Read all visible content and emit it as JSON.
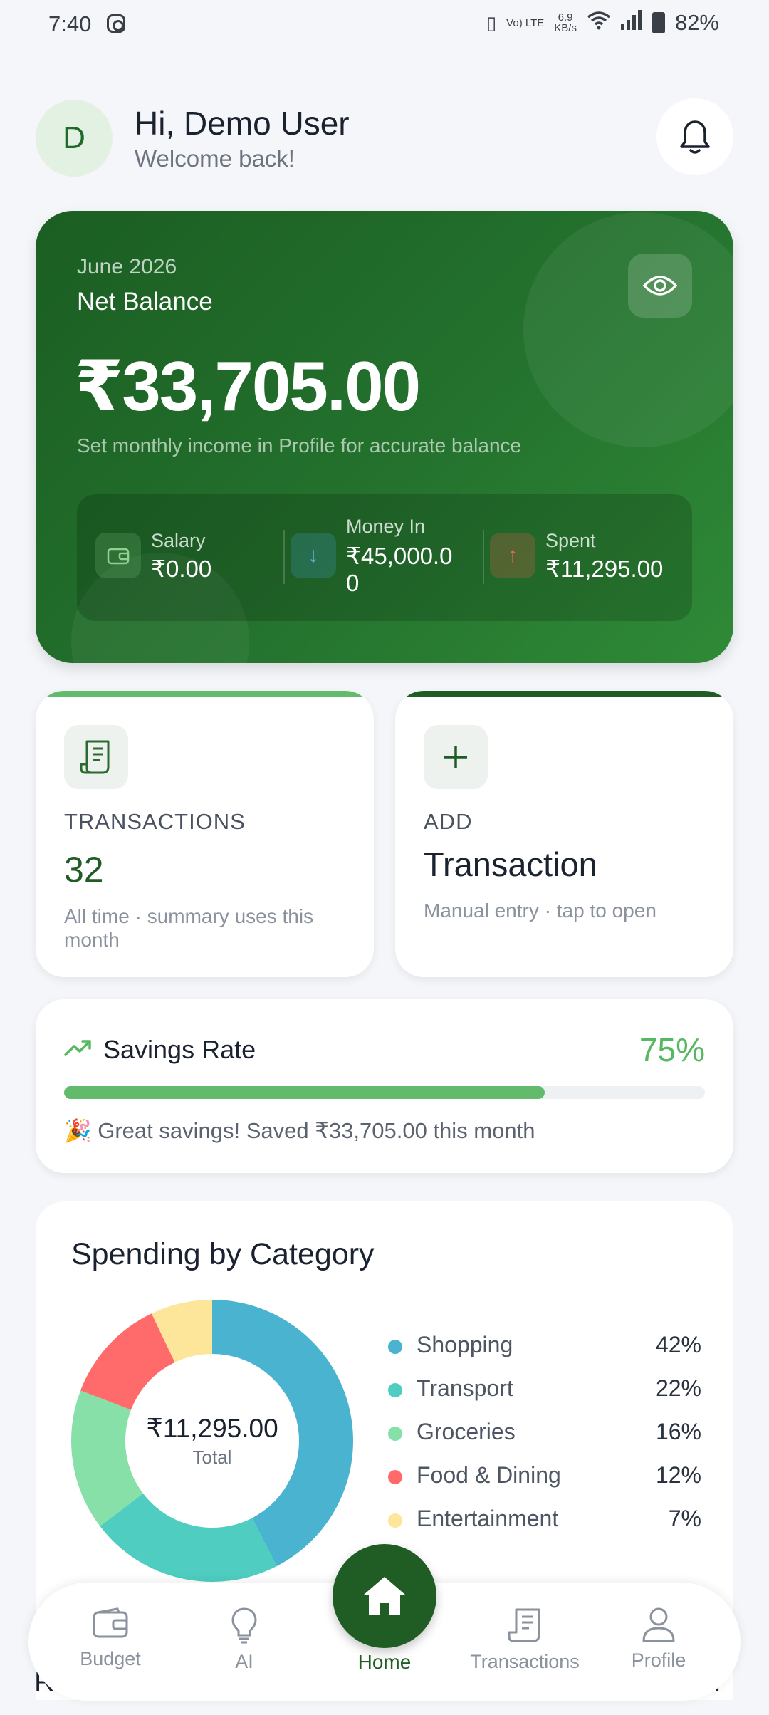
{
  "status_bar": {
    "time": "7:40",
    "net_speed_value": "6.9",
    "net_speed_unit": "KB/s",
    "volte": "Vo) LTE",
    "battery": "82%"
  },
  "header": {
    "avatar_letter": "D",
    "greeting": "Hi, Demo User",
    "subtitle": "Welcome back!"
  },
  "balance": {
    "month": "June 2026",
    "label": "Net Balance",
    "amount": "₹33,705.00",
    "note": "Set monthly income in Profile for accurate balance",
    "stats": [
      {
        "label": "Salary",
        "value": "₹0.00",
        "icon": "wallet-icon",
        "color": "#7bc47f"
      },
      {
        "label": "Money In",
        "value": "₹45,000.0",
        "value_line2": "0",
        "icon": "arrow-down-icon",
        "color": "#4aa3df"
      },
      {
        "label": "Spent",
        "value": "₹11,295.00",
        "icon": "arrow-up-icon",
        "color": "#e8604c"
      }
    ]
  },
  "cards": {
    "transactions": {
      "caption": "TRANSACTIONS",
      "count": "32",
      "sub1": "All time",
      "sub2": "summary uses this month",
      "accent": "#62bb6b"
    },
    "add": {
      "caption": "ADD",
      "title": "Transaction",
      "sub1": "Manual entry",
      "sub2": "tap to open",
      "accent": "#1f5d25"
    }
  },
  "savings": {
    "title": "Savings Rate",
    "percent_label": "75%",
    "percent": 75,
    "message": "🎉 Great savings!  Saved ₹33,705.00 this month"
  },
  "spending": {
    "title": "Spending by Category",
    "total": "₹11,295.00",
    "total_label": "Total",
    "categories": [
      {
        "name": "Shopping",
        "pct": 42,
        "label": "42%",
        "color": "#4ab4d0"
      },
      {
        "name": "Transport",
        "pct": 22,
        "label": "22%",
        "color": "#4ecdc0"
      },
      {
        "name": "Groceries",
        "pct": 16,
        "label": "16%",
        "color": "#86e0a8"
      },
      {
        "name": "Food & Dining",
        "pct": 12,
        "label": "12%",
        "color": "#ff6b6b"
      },
      {
        "name": "Entertainment",
        "pct": 7,
        "label": "7%",
        "color": "#fde59a"
      }
    ]
  },
  "nav": {
    "items": [
      {
        "label": "Budget",
        "icon": "wallet-icon"
      },
      {
        "label": "AI",
        "icon": "lightbulb-icon"
      },
      {
        "label": "Home",
        "icon": "home-icon"
      },
      {
        "label": "Transactions",
        "icon": "receipt-icon"
      },
      {
        "label": "Profile",
        "icon": "user-icon"
      }
    ],
    "peek_left": "R",
    "peek_right": "ll"
  }
}
